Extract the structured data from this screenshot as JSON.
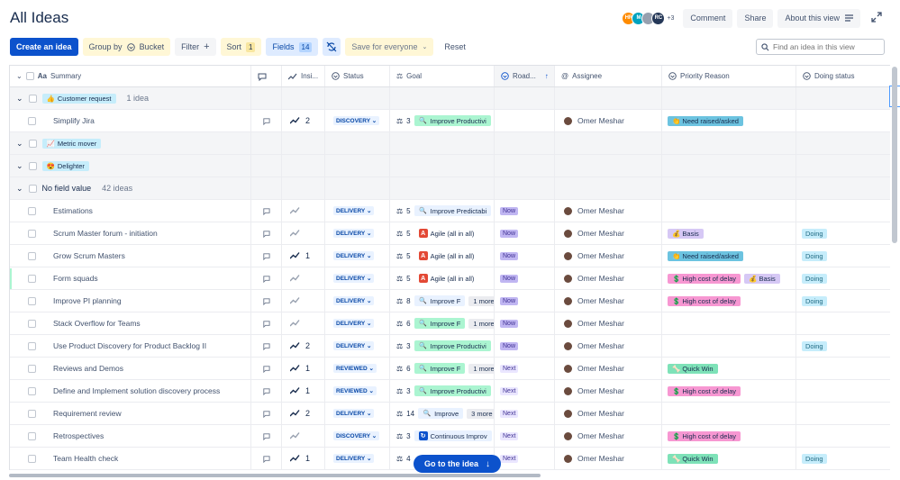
{
  "page": {
    "title": "All Ideas"
  },
  "header": {
    "avatars": [
      {
        "initials": "HR",
        "color": "#ff8b00"
      },
      {
        "initials": "M",
        "color": "#00a3bf"
      },
      {
        "initials": "",
        "color": "#97a0af"
      },
      {
        "initials": "RC",
        "color": "#253858"
      }
    ],
    "more_count": "+3",
    "comment_label": "Comment",
    "share_label": "Share",
    "about_label": "About this view"
  },
  "toolbar": {
    "create_label": "Create an idea",
    "group_by_label": "Group by",
    "group_by_value": "Bucket",
    "filter_label": "Filter",
    "sort_label": "Sort",
    "sort_count": "1",
    "fields_label": "Fields",
    "fields_count": "14",
    "save_label": "Save for everyone",
    "reset_label": "Reset"
  },
  "search": {
    "placeholder": "Find an idea in this view"
  },
  "columns": {
    "summary": "Summary",
    "insights": "Insi...",
    "status": "Status",
    "goal": "Goal",
    "roadmap": "Road...",
    "assignee": "Assignee",
    "priority": "Priority Reason",
    "doing": "Doing status"
  },
  "groups": {
    "customer_request": {
      "emoji": "👍",
      "label": "Customer request",
      "count": "1 idea"
    },
    "metric_mover": {
      "emoji": "📈",
      "label": "Metric mover"
    },
    "delighter": {
      "emoji": "😍",
      "label": "Delighter"
    },
    "no_value": {
      "label": "No field value",
      "count": "42 ideas"
    }
  },
  "rows": [
    {
      "summary": "Simplify Jira",
      "insights": "2",
      "status": "DISCOVERY",
      "goal_count": "3",
      "goal_icon": "🔍",
      "goal_label": "Improve Productivi",
      "goal_color": "#abf5d1",
      "goal_more": "",
      "roadmap": "",
      "assignee": "Omer Meshar",
      "prio1": "👏 Need raised/asked",
      "prio1_color": "#6cc3e0",
      "prio2": "",
      "prio2_color": "",
      "doing": ""
    },
    {
      "summary": "Estimations",
      "insights": "",
      "status": "DELIVERY",
      "goal_count": "5",
      "goal_icon": "🔍",
      "goal_label": "Improve Predictabi",
      "goal_color": "#e9f2ff",
      "goal_more": "",
      "roadmap": "Now",
      "assignee": "Omer Meshar",
      "prio1": "",
      "prio1_color": "",
      "prio2": "",
      "prio2_color": "",
      "doing": ""
    },
    {
      "summary": "Scrum Master forum - initiation",
      "insights": "",
      "status": "DELIVERY",
      "goal_count": "5",
      "goal_icon": "A",
      "goal_label": "Agile (all in all)",
      "goal_color": "",
      "goal_more": "",
      "roadmap": "Now",
      "assignee": "Omer Meshar",
      "prio1": "💰 Basis",
      "prio1_color": "#d6c8f5",
      "prio2": "",
      "prio2_color": "",
      "doing": "Doing"
    },
    {
      "summary": "Grow Scrum Masters",
      "insights": "1",
      "status": "DELIVERY",
      "goal_count": "5",
      "goal_icon": "A",
      "goal_label": "Agile (all in all)",
      "goal_color": "",
      "goal_more": "",
      "roadmap": "Now",
      "assignee": "Omer Meshar",
      "prio1": "👏 Need raised/asked",
      "prio1_color": "#6cc3e0",
      "prio2": "",
      "prio2_color": "",
      "doing": "Doing"
    },
    {
      "summary": "Form squads",
      "insights": "",
      "status": "DELIVERY",
      "goal_count": "5",
      "goal_icon": "A",
      "goal_label": "Agile (all in all)",
      "goal_color": "",
      "goal_more": "",
      "roadmap": "Now",
      "assignee": "Omer Meshar",
      "prio1": "💲 High cost of delay",
      "prio1_color": "#f797d2",
      "prio2": "💰 Basis",
      "prio2_color": "#d6c8f5",
      "doing": "Doing"
    },
    {
      "summary": "Improve PI planning",
      "insights": "",
      "status": "DELIVERY",
      "goal_count": "8",
      "goal_icon": "🔍",
      "goal_label": "Improve F",
      "goal_color": "#e9f2ff",
      "goal_more": "1 more",
      "roadmap": "Now",
      "assignee": "Omer Meshar",
      "prio1": "💲 High cost of delay",
      "prio1_color": "#f797d2",
      "prio2": "",
      "prio2_color": "",
      "doing": "Doing"
    },
    {
      "summary": "Stack Overflow for Teams",
      "insights": "",
      "status": "DELIVERY",
      "goal_count": "6",
      "goal_icon": "🔍",
      "goal_label": "Improve F",
      "goal_color": "#abf5d1",
      "goal_more": "1 more",
      "roadmap": "Now",
      "assignee": "Omer Meshar",
      "prio1": "",
      "prio1_color": "",
      "prio2": "",
      "prio2_color": "",
      "doing": ""
    },
    {
      "summary": "Use Product Discovery for Product Backlog II",
      "insights": "2",
      "status": "DELIVERY",
      "goal_count": "3",
      "goal_icon": "🔍",
      "goal_label": "Improve Productivi",
      "goal_color": "#abf5d1",
      "goal_more": "",
      "roadmap": "Now",
      "assignee": "Omer Meshar",
      "prio1": "",
      "prio1_color": "",
      "prio2": "",
      "prio2_color": "",
      "doing": "Doing"
    },
    {
      "summary": "Reviews and Demos",
      "insights": "1",
      "status": "REVIEWED",
      "goal_count": "6",
      "goal_icon": "🔍",
      "goal_label": "Improve F",
      "goal_color": "#abf5d1",
      "goal_more": "1 more",
      "roadmap": "Next",
      "assignee": "Omer Meshar",
      "prio1": "🦴 Quick Win",
      "prio1_color": "#7ee2b8",
      "prio2": "",
      "prio2_color": "",
      "doing": ""
    },
    {
      "summary": "Define and Implement solution discovery process",
      "insights": "1",
      "status": "REVIEWED",
      "goal_count": "3",
      "goal_icon": "🔍",
      "goal_label": "Improve Productivi",
      "goal_color": "#abf5d1",
      "goal_more": "",
      "roadmap": "Next",
      "assignee": "Omer Meshar",
      "prio1": "💲 High cost of delay",
      "prio1_color": "#f797d2",
      "prio2": "",
      "prio2_color": "",
      "doing": ""
    },
    {
      "summary": "Requirement review",
      "insights": "2",
      "status": "DELIVERY",
      "goal_count": "14",
      "goal_icon": "🔍",
      "goal_label": "Improve",
      "goal_color": "#e9f2ff",
      "goal_more": "3 more",
      "roadmap": "Next",
      "assignee": "Omer Meshar",
      "prio1": "",
      "prio1_color": "",
      "prio2": "",
      "prio2_color": "",
      "doing": ""
    },
    {
      "summary": "Retrospectives",
      "insights": "",
      "status": "DISCOVERY",
      "goal_count": "3",
      "goal_icon": "↻",
      "goal_label": "Continuous Improv",
      "goal_color": "#e9f2ff",
      "goal_more": "",
      "roadmap": "Next",
      "assignee": "Omer Meshar",
      "prio1": "💲 High cost of delay",
      "prio1_color": "#f797d2",
      "prio2": "",
      "prio2_color": "",
      "doing": ""
    },
    {
      "summary": "Team Health check",
      "insights": "1",
      "status": "DELIVERY",
      "goal_count": "4",
      "goal_icon": "🔍",
      "goal_label": "",
      "goal_color": "",
      "goal_more": "",
      "roadmap": "Next",
      "assignee": "Omer Meshar",
      "prio1": "🦴 Quick Win",
      "prio1_color": "#7ee2b8",
      "prio2": "",
      "prio2_color": "",
      "doing": "Doing"
    }
  ],
  "goto_label": "Go to the idea"
}
